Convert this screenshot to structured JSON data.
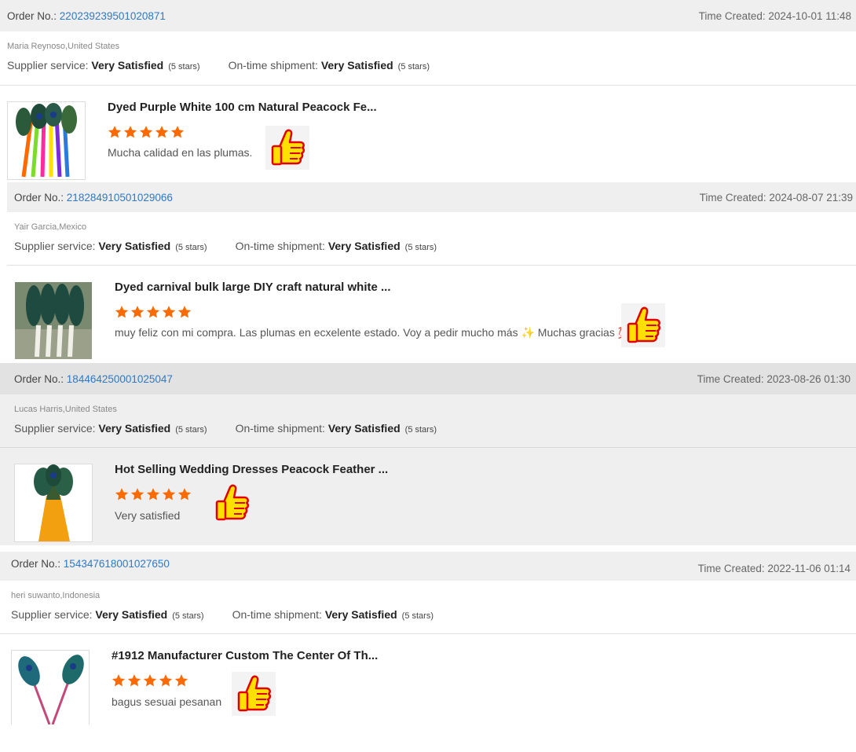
{
  "labels": {
    "order_no": "Order No.:",
    "time_created": "Time Created:",
    "supplier_service": "Supplier service:",
    "on_time_shipment": "On-time shipment:"
  },
  "colors": {
    "link": "#2f79c5",
    "star": "#ff6a00",
    "header_bg": "#efefef"
  },
  "reviews": [
    {
      "order_no": "220239239501020871",
      "time_created": "2024-10-01 11:48",
      "buyer": "Maria Reynoso,United States",
      "supplier_service": "Very Satisfied",
      "supplier_stars": "(5 stars)",
      "shipment": "Very Satisfied",
      "shipment_stars": "(5 stars)",
      "product_name": "Dyed Purple White 100 cm Natural Peacock Fe...",
      "rating": 5,
      "comment": "Mucha calidad en las plumas.",
      "icon": "thumbs-up-icon"
    },
    {
      "order_no": "218284910501029066",
      "time_created": "2024-08-07 21:39",
      "buyer": "Yair Garcia,Mexico",
      "supplier_service": "Very Satisfied",
      "supplier_stars": "(5 stars)",
      "shipment": "Very Satisfied",
      "shipment_stars": "(5 stars)",
      "product_name": "Dyed carnival bulk large DIY craft natural white ...",
      "rating": 5,
      "comment": "muy feliz con mi compra. Las plumas en ecxelente estado. Voy a pedir mucho más ✨ Muchas gracias 💯",
      "icon": "thumbs-up-icon"
    },
    {
      "order_no": "184464250001025047",
      "time_created": "2023-08-26 01:30",
      "buyer": "Lucas Harris,United States",
      "supplier_service": "Very Satisfied",
      "supplier_stars": "(5 stars)",
      "shipment": "Very Satisfied",
      "shipment_stars": "(5 stars)",
      "product_name": "Hot Selling Wedding Dresses Peacock Feather ...",
      "rating": 5,
      "comment": "Very satisfied",
      "icon": "thumbs-up-icon"
    },
    {
      "order_no": "154347618001027650",
      "time_created": "2022-11-06 01:14",
      "buyer": "heri suwanto,Indonesia",
      "supplier_service": "Very Satisfied",
      "supplier_stars": "(5 stars)",
      "shipment": "Very Satisfied",
      "shipment_stars": "(5 stars)",
      "product_name": "#1912 Manufacturer Custom The Center Of Th...",
      "rating": 5,
      "comment": "bagus sesuai pesanan",
      "icon": "thumbs-up-icon"
    }
  ]
}
